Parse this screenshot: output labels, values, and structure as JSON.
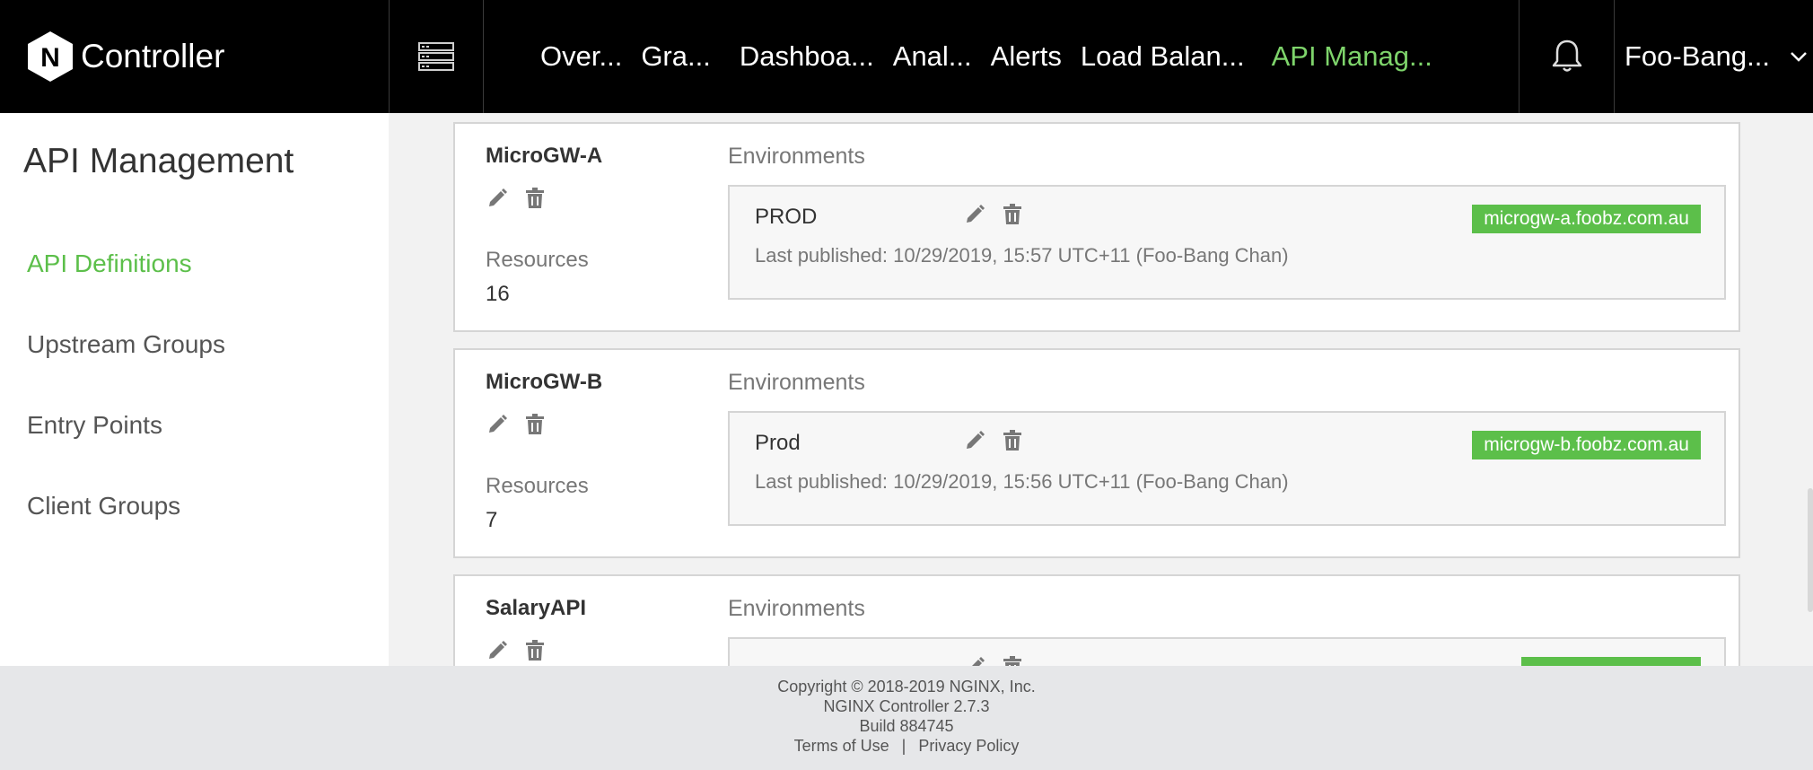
{
  "header": {
    "logo_letter": "N",
    "app_title": "Controller",
    "nav": [
      {
        "label": "Over...",
        "active": false
      },
      {
        "label": "Gra...",
        "active": false
      },
      {
        "label": "Dashboa...",
        "active": false
      },
      {
        "label": "Anal...",
        "active": false
      },
      {
        "label": "Alerts",
        "active": false
      },
      {
        "label": "Load Balan...",
        "active": false
      },
      {
        "label": "API Manag...",
        "active": true
      }
    ],
    "user": "Foo-Bang..."
  },
  "sidebar": {
    "title": "API Management",
    "items": [
      {
        "label": "API Definitions",
        "active": true
      },
      {
        "label": "Upstream Groups",
        "active": false
      },
      {
        "label": "Entry Points",
        "active": false
      },
      {
        "label": "Client Groups",
        "active": false
      }
    ]
  },
  "apis": [
    {
      "name": "MicroGW-A",
      "resources_label": "Resources",
      "resources": "16",
      "environments_label": "Environments",
      "env": {
        "name": "PROD",
        "published": "Last published: 10/29/2019, 15:57 UTC+11 (Foo-Bang Chan)",
        "host": "microgw-a.foobz.com.au"
      }
    },
    {
      "name": "MicroGW-B",
      "resources_label": "Resources",
      "resources": "7",
      "environments_label": "Environments",
      "env": {
        "name": "Prod",
        "published": "Last published: 10/29/2019, 15:56 UTC+11 (Foo-Bang Chan)",
        "host": "microgw-b.foobz.com.au"
      }
    },
    {
      "name": "SalaryAPI",
      "environments_label": "Environments"
    }
  ],
  "footer": {
    "copyright": "Copyright © 2018-2019 NGINX, Inc.",
    "version": "NGINX Controller 2.7.3",
    "build": "Build 884745",
    "terms": "Terms of Use",
    "separator": "|",
    "privacy": "Privacy Policy"
  },
  "colors": {
    "accent": "#5cbf4a",
    "nav_active": "#7ed46b",
    "header_bg": "#000000"
  },
  "icons": [
    "nginx-logo-icon",
    "grid-menu-icon",
    "bell-icon",
    "chevron-down-icon",
    "edit-pencil-icon",
    "trash-icon"
  ]
}
